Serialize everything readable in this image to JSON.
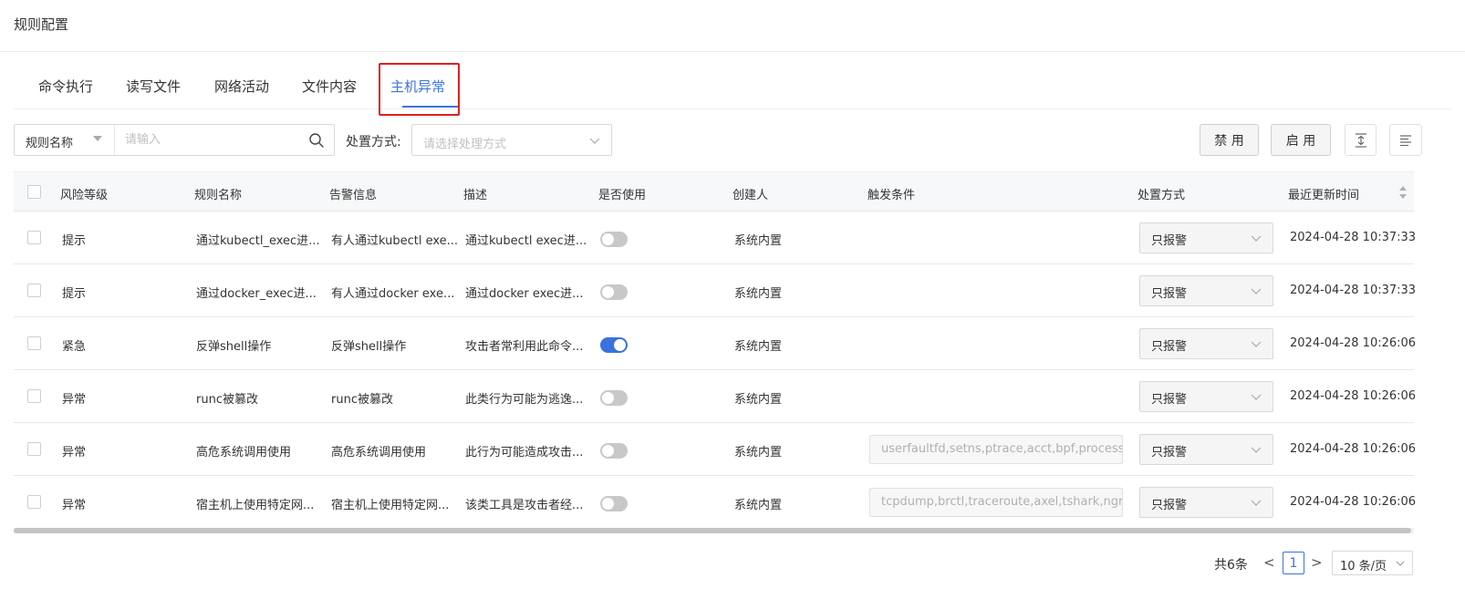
{
  "page": {
    "title": "规则配置"
  },
  "tabs": [
    {
      "label": "命令执行"
    },
    {
      "label": "读写文件"
    },
    {
      "label": "网络活动"
    },
    {
      "label": "文件内容"
    },
    {
      "label": "主机异常",
      "active": true
    }
  ],
  "toolbar": {
    "field_select": "规则名称",
    "search_placeholder": "请输入",
    "filter_label": "处置方式:",
    "filter_placeholder": "请选择处理方式",
    "disable_label": "禁 用",
    "enable_label": "启 用"
  },
  "table": {
    "headers": [
      "风险等级",
      "规则名称",
      "告警信息",
      "描述",
      "是否使用",
      "创建人",
      "触发条件",
      "处置方式",
      "最近更新时间"
    ],
    "rows": [
      {
        "risk": "提示",
        "name": "通过kubectl_exec进...",
        "alert": "有人通过kubectl exe...",
        "desc": "通过kubectl exec进...",
        "enabled": false,
        "creator": "系统内置",
        "trigger": "",
        "action": "只报警",
        "updated": "2024-04-28 10:37:33"
      },
      {
        "risk": "提示",
        "name": "通过docker_exec进...",
        "alert": "有人通过docker exe...",
        "desc": "通过docker exec进...",
        "enabled": false,
        "creator": "系统内置",
        "trigger": "",
        "action": "只报警",
        "updated": "2024-04-28 10:37:33"
      },
      {
        "risk": "紧急",
        "name": "反弹shell操作",
        "alert": "反弹shell操作",
        "desc": "攻击者常利用此命令...",
        "enabled": true,
        "creator": "系统内置",
        "trigger": "",
        "action": "只报警",
        "updated": "2024-04-28 10:26:06"
      },
      {
        "risk": "异常",
        "name": "runc被篡改",
        "alert": "runc被篡改",
        "desc": "此类行为可能为逃逸...",
        "enabled": false,
        "creator": "系统内置",
        "trigger": "",
        "action": "只报警",
        "updated": "2024-04-28 10:26:06"
      },
      {
        "risk": "异常",
        "name": "高危系统调用使用",
        "alert": "高危系统调用使用",
        "desc": "此行为可能造成攻击...",
        "enabled": false,
        "creator": "系统内置",
        "trigger": "userfaultfd,setns,ptrace,acct,bpf,process_vi",
        "action": "只报警",
        "updated": "2024-04-28 10:26:06"
      },
      {
        "risk": "异常",
        "name": "宿主机上使用特定网...",
        "alert": "宿主机上使用特定网...",
        "desc": "该类工具是攻击者经...",
        "enabled": false,
        "creator": "系统内置",
        "trigger": "tcpdump,brctl,traceroute,axel,tshark,ngrep",
        "action": "只报警",
        "updated": "2024-04-28 10:26:06"
      }
    ]
  },
  "pagination": {
    "total": "共6条",
    "prev": "<",
    "current": "1",
    "next": ">",
    "page_size": "10 条/页"
  },
  "colors": {
    "accent": "#3b71e0",
    "highlight": "#e02020"
  }
}
